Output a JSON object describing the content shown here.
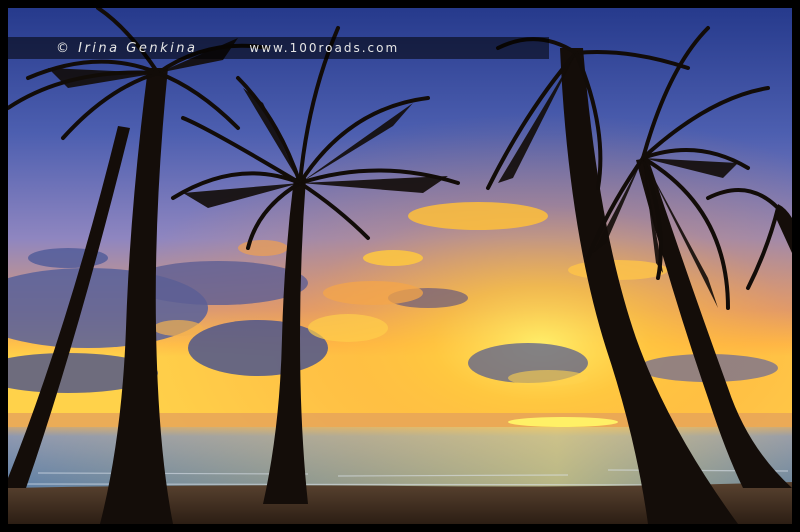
{
  "watermark": {
    "credit": "© Irina Genkina",
    "url": "www.100roads.com"
  },
  "scene": {
    "subject": "palm-trees-at-sunrise-beach",
    "colors": {
      "sky_top": "#2a3f8e",
      "sky_mid": "#6b6fb0",
      "glow": "#ffcc33",
      "sea": "#6f8fae",
      "sand": "#3b2a1e",
      "silhouette": "#120c08"
    }
  }
}
